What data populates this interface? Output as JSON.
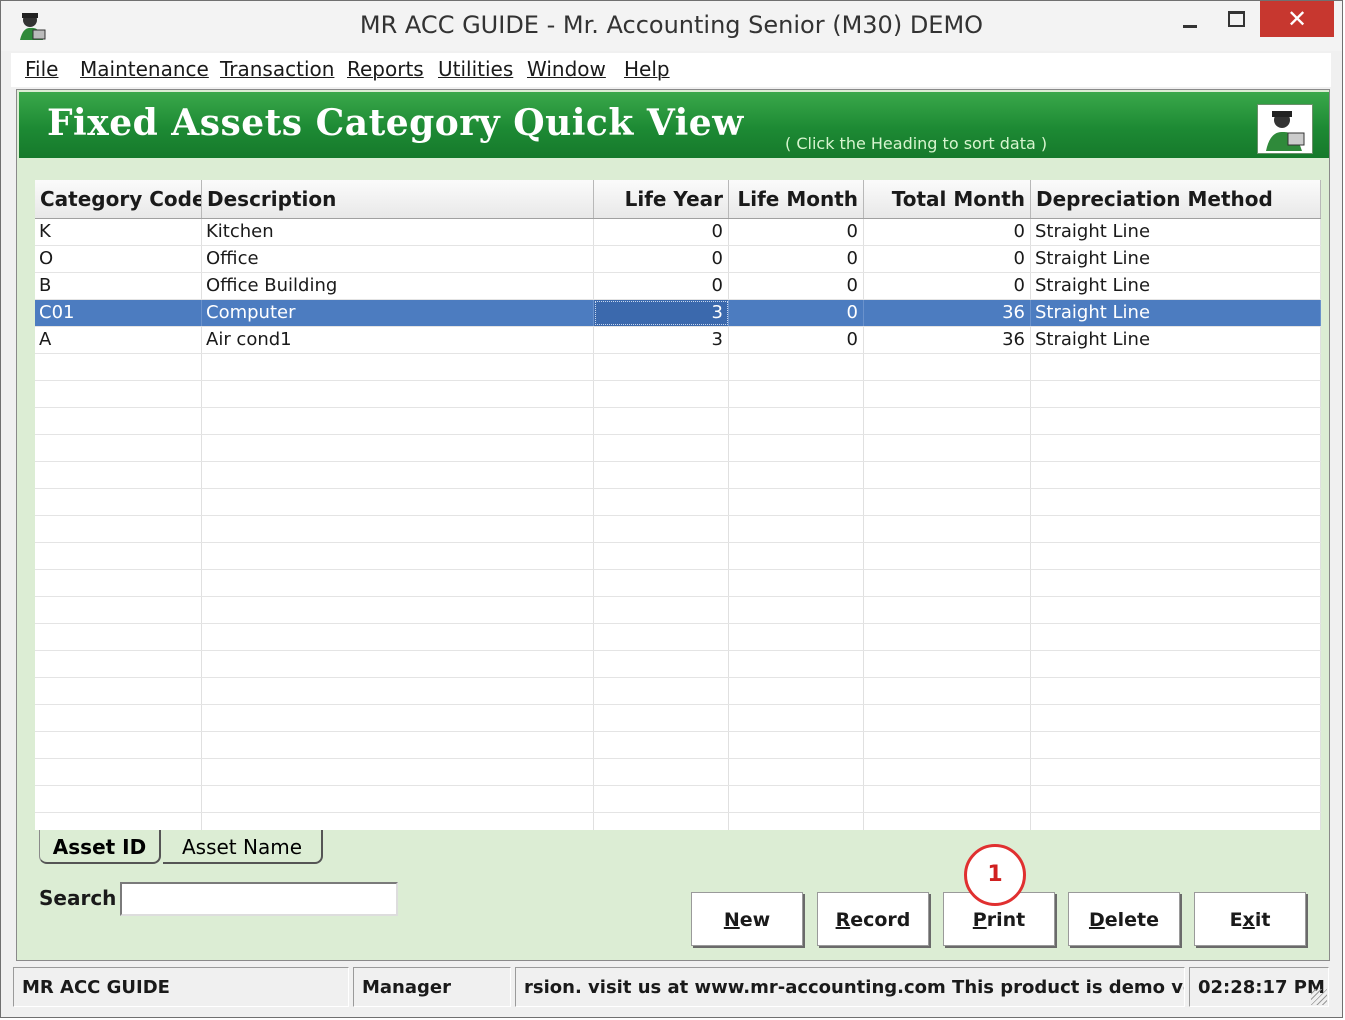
{
  "window": {
    "title": "MR ACC GUIDE - Mr. Accounting Senior (M30) DEMO",
    "close_glyph": "✕"
  },
  "menu": [
    "File",
    "Maintenance",
    "Transaction",
    "Reports",
    "Utilities",
    "Window",
    "Help"
  ],
  "banner": {
    "title": "Fixed Assets Category Quick View",
    "hint": "( Click the Heading to sort data )",
    "logo_icon": "mr-accounting-logo-icon"
  },
  "grid": {
    "columns": [
      "Category Code",
      "Description",
      "Life Year",
      "Life Month",
      "Total Month",
      "Depreciation Method"
    ],
    "rows": [
      [
        "K",
        "Kitchen",
        "0",
        "0",
        "0",
        "Straight Line"
      ],
      [
        "O",
        "Office",
        "0",
        "0",
        "0",
        "Straight Line"
      ],
      [
        "B",
        "Office Building",
        "0",
        "0",
        "0",
        "Straight Line"
      ],
      [
        "C01",
        "Computer",
        "3",
        "0",
        "36",
        "Straight Line"
      ],
      [
        "A",
        "Air cond1",
        "3",
        "0",
        "36",
        "Straight Line"
      ]
    ],
    "selected_row": 3
  },
  "tabs": {
    "active": "Asset ID",
    "inactive": "Asset Name"
  },
  "search": {
    "label": "Search",
    "value": ""
  },
  "buttons": {
    "new": {
      "mnemonic": "N",
      "rest": "ew"
    },
    "record": {
      "mnemonic": "R",
      "rest": "ecord"
    },
    "print": {
      "mnemonic": "P",
      "rest": "rint"
    },
    "delete": {
      "mnemonic": "D",
      "rest": "elete"
    },
    "exit": {
      "pre": "E",
      "mnemonic": "x",
      "rest": "it"
    }
  },
  "annotation": "1",
  "status": {
    "app": "MR ACC GUIDE",
    "user": "Manager",
    "message": "rsion.  visit us at www.mr-accounting.com This product is demo ve",
    "time": "02:28:17 PM"
  }
}
